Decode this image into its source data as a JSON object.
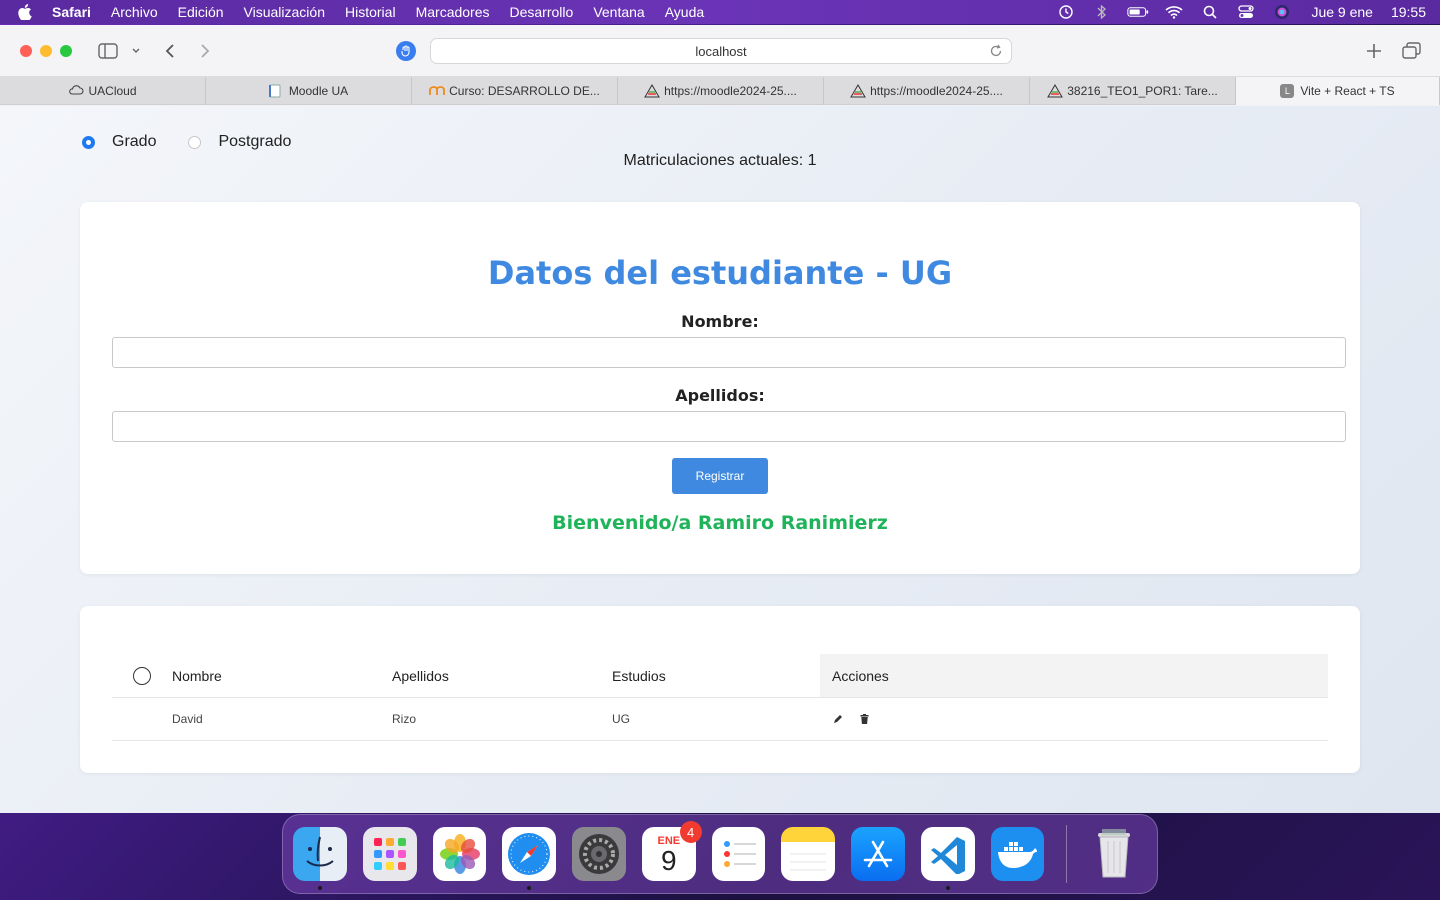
{
  "menubar": {
    "app": "Safari",
    "items": [
      "Archivo",
      "Edición",
      "Visualización",
      "Historial",
      "Marcadores",
      "Desarrollo",
      "Ventana",
      "Ayuda"
    ],
    "date": "Jue 9 ene",
    "time": "19:55"
  },
  "browser": {
    "address": "localhost",
    "tabs": [
      {
        "label": "UACloud",
        "icon": "cloud-icon"
      },
      {
        "label": "Moodle UA",
        "icon": "document-icon"
      },
      {
        "label": "Curso: DESARROLLO DE...",
        "icon": "moodle-icon"
      },
      {
        "label": "https://moodle2024-25....",
        "icon": "triangle-icon"
      },
      {
        "label": "https://moodle2024-25....",
        "icon": "triangle-icon"
      },
      {
        "label": "38216_TEO1_POR1: Tare...",
        "icon": "triangle-icon"
      },
      {
        "label": "Vite + React + TS",
        "icon": "letter-l-icon",
        "favicon_letter": "L",
        "active": true
      }
    ]
  },
  "page": {
    "radio_grado": "Grado",
    "radio_postgrado": "Postgrado",
    "selected": "Grado",
    "matriculaciones": "Matriculaciones actuales: 1",
    "form": {
      "title": "Datos del estudiante - UG",
      "nombre_label": "Nombre:",
      "nombre_value": "",
      "apellidos_label": "Apellidos:",
      "apellidos_value": "",
      "submit": "Registrar",
      "welcome": "Bienvenido/a Ramiro Ranimierz"
    },
    "table": {
      "headers": {
        "nombre": "Nombre",
        "apellidos": "Apellidos",
        "estudios": "Estudios",
        "acciones": "Acciones"
      },
      "rows": [
        {
          "nombre": "David",
          "apellidos": "Rizo",
          "estudios": "UG"
        }
      ]
    }
  },
  "dock": {
    "apps": [
      "Finder",
      "Launchpad",
      "Fotos",
      "Safari",
      "Ajustes del Sistema",
      "Calendario",
      "Recordatorios",
      "Notas",
      "App Store",
      "Visual Studio Code",
      "Docker",
      "Papelera"
    ],
    "calendar_month": "ENE",
    "calendar_day": "9",
    "calendar_badge": "4"
  },
  "colors": {
    "accent": "#3f8ae0",
    "success": "#1fb35a",
    "radio_selected": "#1f7af0"
  }
}
